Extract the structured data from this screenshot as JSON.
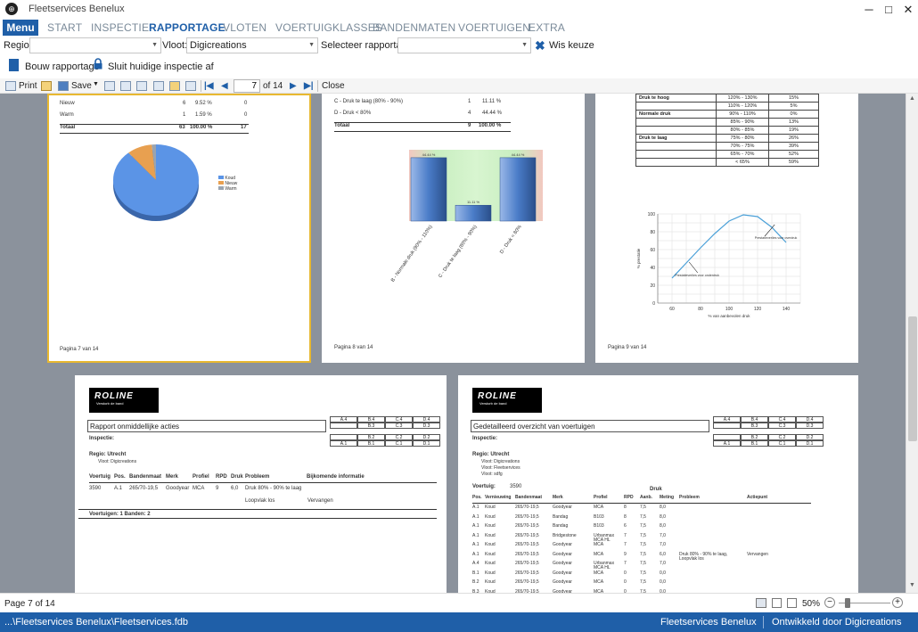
{
  "window": {
    "title": "Fleetservices Benelux",
    "minimize": "─",
    "maximize": "□",
    "close": "✕"
  },
  "ribbon": {
    "menu_label": "Menu",
    "tabs": [
      "START",
      "INSPECTIE",
      "RAPPORTAGE",
      "VLOTEN",
      "VOERTUIGKLASSES",
      "BANDENMATEN",
      "VOERTUIGEN",
      "EXTRA"
    ],
    "active_tab": "RAPPORTAGE"
  },
  "filters": {
    "regio_label": "Regio:",
    "regio_value": "",
    "vloot_label": "Vloot:",
    "vloot_value": "Digicreations",
    "rapportage_label": "Selecteer rapportage",
    "rapportage_value": "",
    "clear_label": "Wis keuze"
  },
  "actions": {
    "build_report": "Bouw rapportage",
    "close_inspection": "Sluit huidige inspectie af"
  },
  "toolbar": {
    "print": "Print",
    "save": "Save",
    "page_current": "7",
    "page_of": "of 14",
    "close": "Close"
  },
  "pages": {
    "p7": {
      "rows": [
        {
          "label": "Nieuw",
          "count": "6",
          "pct": "9.52 %",
          "extra": "0"
        },
        {
          "label": "Warm",
          "count": "1",
          "pct": "1.59 %",
          "extra": "0"
        },
        {
          "label": "Totaal",
          "count": "63",
          "pct": "100.00 %",
          "extra": "17"
        }
      ],
      "legend": [
        "Koud",
        "Nieuw",
        "Warm"
      ],
      "footer": "Pagina 7 van 14"
    },
    "p8": {
      "rows": [
        {
          "label": "C - Druk te laag (80% - 90%)",
          "count": "1",
          "pct": "11.11 %"
        },
        {
          "label": "D - Druk < 80%",
          "count": "4",
          "pct": "44.44 %"
        },
        {
          "label": "Totaal",
          "count": "9",
          "pct": "100.00 %"
        }
      ],
      "footer": "Pagina 8 van 14"
    },
    "p9": {
      "table": [
        {
          "group": "Druk te hoog",
          "range": "120% - 130%",
          "pct": "15%"
        },
        {
          "group": "",
          "range": "110% - 120%",
          "pct": "5%"
        },
        {
          "group": "Normale druk",
          "range": "90% - 110%",
          "pct": "0%"
        },
        {
          "group": "",
          "range": "85% - 90%",
          "pct": "13%"
        },
        {
          "group": "",
          "range": "80% - 85%",
          "pct": "19%"
        },
        {
          "group": "Druk te laag",
          "range": "75% - 80%",
          "pct": "26%"
        },
        {
          "group": "",
          "range": "70% - 75%",
          "pct": "39%"
        },
        {
          "group": "",
          "range": "65% - 70%",
          "pct": "52%"
        },
        {
          "group": "",
          "range": "< 65%",
          "pct": "59%"
        }
      ],
      "curve_label_high": "Prestatieverlies voor overdruk",
      "curve_label_low": "Prestatieverlies voor onderdruk",
      "xlabel": "% van aanbevolen druk",
      "ylabel": "% prestatie",
      "footer": "Pagina 9 van 14"
    },
    "p10": {
      "logo": "ROLINE",
      "logo_sub": "Verstorb de band",
      "title": "Rapport onmiddellijke acties",
      "inspectie": "Inspectie:",
      "regio": "Regio: Utrecht",
      "vloot": "Vloot: Digicreations",
      "headers": [
        "Voertuig",
        "Pos.",
        "Bandenmaat",
        "Merk",
        "Profiel",
        "RPD",
        "Druk",
        "Probleem",
        "Bijkomende informatie"
      ],
      "row": [
        "3590",
        "A.1",
        "265/70-19,5",
        "Goodyear",
        "MCA",
        "9",
        "6,0",
        "Druk 80% - 90% te laag",
        ""
      ],
      "row2_problem": "Loopvlak los",
      "row2_info": "Vervangen",
      "summary": "Voertuigen:  1  Banden:  2"
    },
    "p11": {
      "title": "Gedetailleerd overzicht van voertuigen",
      "inspectie": "Inspectie:",
      "regio": "Regio: Utrecht",
      "vloten": [
        "Vloot: Digicreations",
        "Vloot: Fleetservices",
        "Vloot: sdfg"
      ],
      "voertuig_label": "Voertuig:",
      "voertuig_value": "3590",
      "druk_label": "Druk",
      "headers": [
        "Pos.",
        "Vernieuwing",
        "Bandenmaat",
        "Merk",
        "Profiel",
        "RPD",
        "Aanb.",
        "Meting",
        "Probleem",
        "Actiepunt"
      ],
      "rows": [
        [
          "A.1",
          "Koud",
          "265/70-19,5",
          "Goodyear",
          "MCA",
          "8",
          "7,5",
          "8,0",
          "",
          ""
        ],
        [
          "A.1",
          "Koud",
          "265/70-19,5",
          "Bandag",
          "B103",
          "8",
          "7,5",
          "8,0",
          "",
          ""
        ],
        [
          "A.1",
          "Koud",
          "265/70-19,5",
          "Bandag",
          "B103",
          "6",
          "7,5",
          "8,0",
          "",
          ""
        ],
        [
          "A.1",
          "Koud",
          "265/70-19,5",
          "Bridgestone",
          "Urbanmax MCA HL",
          "7",
          "7,5",
          "7,0",
          "",
          ""
        ],
        [
          "A.1",
          "Koud",
          "265/70-19,5",
          "Goodyear",
          "MCA",
          "7",
          "7,5",
          "7,0",
          "",
          ""
        ],
        [
          "A.1",
          "Koud",
          "265/70-19,5",
          "Goodyear",
          "MCA",
          "9",
          "7,5",
          "6,0",
          "Druk 80% - 90% te laag, Loopvlak los",
          "Vervangen"
        ],
        [
          "A.4",
          "Koud",
          "265/70-19,5",
          "Goodyear",
          "Urbanmax MCA HL",
          "7",
          "7,5",
          "7,0",
          "",
          ""
        ],
        [
          "B.1",
          "Koud",
          "265/70-19,5",
          "Goodyear",
          "MCA",
          "0",
          "7,5",
          "0,0",
          "",
          ""
        ],
        [
          "B.2",
          "Koud",
          "265/70-19,5",
          "Goodyear",
          "MCA",
          "0",
          "7,5",
          "0,0",
          "",
          ""
        ],
        [
          "B.3",
          "Koud",
          "265/70-19,5",
          "Goodyear",
          "MCA",
          "0",
          "7,5",
          "0,0",
          "",
          ""
        ]
      ]
    },
    "axle_grid": [
      [
        "A.4",
        "B.4",
        "C.4",
        "D.4"
      ],
      [
        "",
        "B.3",
        "C.3",
        "D.3"
      ],
      [
        "",
        "B.2",
        "C.2",
        "D.2"
      ],
      [
        "A.1",
        "B.1",
        "C.1",
        "D.1"
      ]
    ]
  },
  "chart_data": [
    {
      "type": "pie",
      "categories": [
        "Koud",
        "Nieuw",
        "Warm"
      ],
      "values": [
        56,
        6,
        1
      ]
    },
    {
      "type": "bar",
      "categories": [
        "B - Normale druk (90% - 110%)",
        "C - Druk te laag (80% - 90%)",
        "D - Druk < 80%"
      ],
      "values": [
        44.44,
        11.11,
        44.44
      ],
      "data_labels": [
        "44.44 %",
        "11.11 %",
        "44.44 %"
      ],
      "ylim": [
        0,
        50
      ]
    },
    {
      "type": "line",
      "x": [
        60,
        70,
        80,
        90,
        100,
        110,
        120,
        130,
        140
      ],
      "y": [
        28,
        45,
        62,
        78,
        92,
        99,
        97,
        85,
        68
      ],
      "xticks": [
        "60",
        "80",
        "100",
        "120",
        "140"
      ],
      "yticks": [
        "0",
        "20",
        "40",
        "60",
        "80",
        "100"
      ],
      "xlabel": "% van aanbevolen druk",
      "ylabel": "% prestatie",
      "xlim": [
        50,
        150
      ],
      "ylim": [
        0,
        100
      ]
    }
  ],
  "status": {
    "page": "Page 7 of 14",
    "zoom": "50%",
    "path": "...\\Fleetservices Benelux\\Fleetservices.fdb",
    "company": "Fleetservices Benelux",
    "developer": "Ontwikkeld door Digicreations"
  },
  "colors": {
    "accent": "#1f5fa8",
    "viewer_bg": "#8b929c",
    "bar_fill": "#4a7cc8",
    "pie_fill": "#5b94e6"
  }
}
